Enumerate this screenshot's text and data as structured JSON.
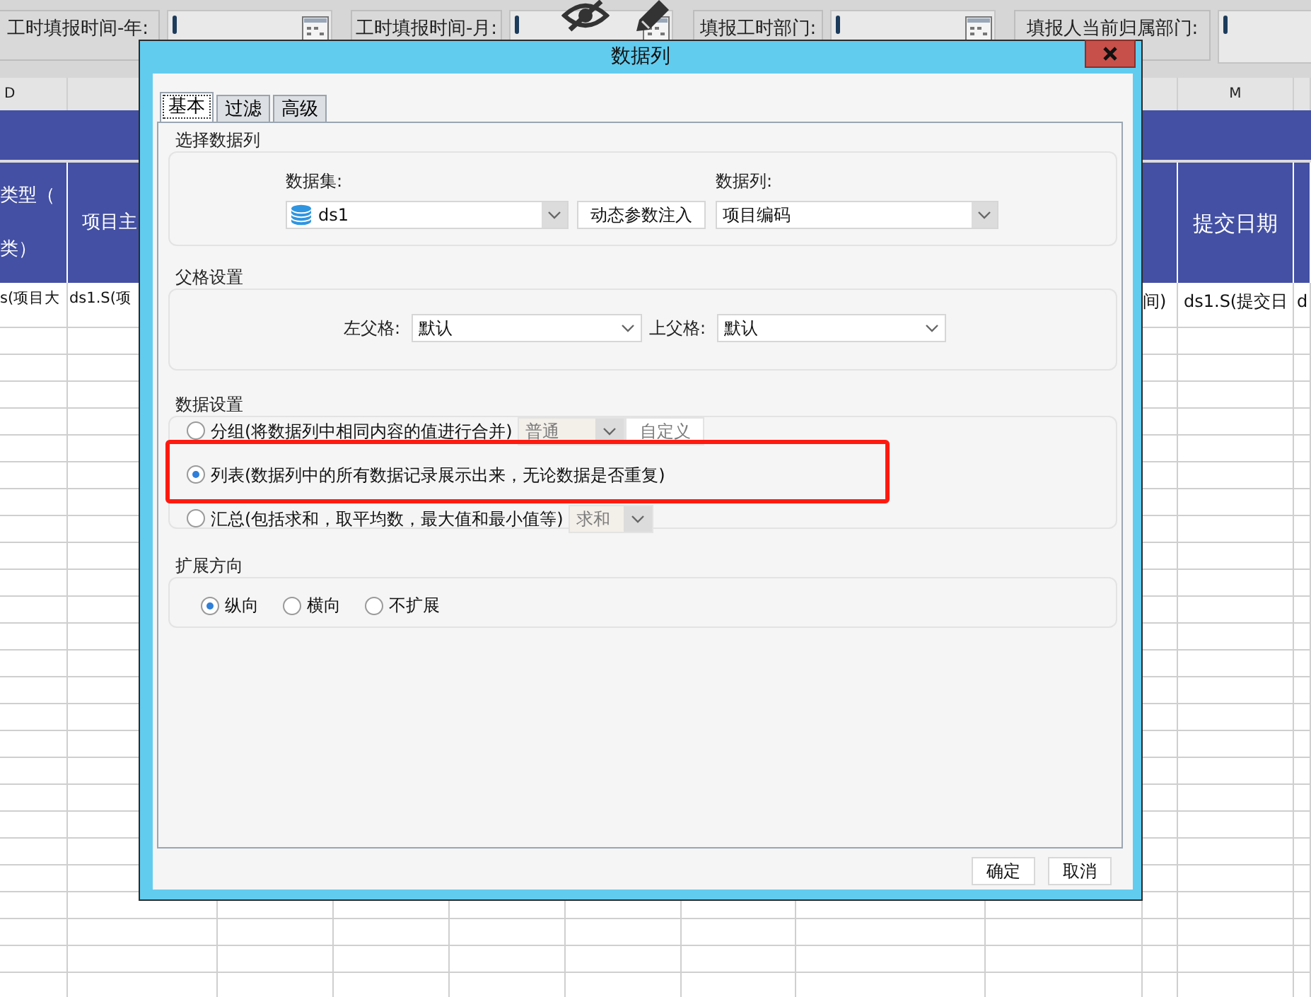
{
  "parameter_bar": [
    {
      "label": "工时填报时间-年:"
    },
    {
      "label": "工时填报时间-月:"
    },
    {
      "label": "填报工时部门:"
    },
    {
      "label": "填报人当前归属部门:"
    }
  ],
  "sheet": {
    "column_letters": [
      "D",
      "M"
    ],
    "header_cells": [
      {
        "lines": [
          "类型（",
          "类）"
        ]
      },
      {
        "lines": [
          "项目主"
        ]
      },
      {
        "lines": [
          "提交日期"
        ]
      }
    ],
    "data_cells": [
      "s(项目大",
      "ds1.S(项",
      "间)",
      "ds1.S(提交日",
      "d"
    ]
  },
  "dialog": {
    "title": "数据列",
    "tabs": [
      {
        "label": "基本",
        "selected": true
      },
      {
        "label": "过滤",
        "selected": false
      },
      {
        "label": "高级",
        "selected": false
      }
    ],
    "select_column": {
      "title": "选择数据列",
      "dataset_label": "数据集:",
      "dataset": {
        "value": "ds1"
      },
      "inject_button": "动态参数注入",
      "column_label": "数据列:",
      "column": {
        "value": "项目编码"
      }
    },
    "parent_settings": {
      "title": "父格设置",
      "left_label": "左父格:",
      "left": {
        "value": "默认"
      },
      "top_label": "上父格:",
      "top": {
        "value": "默认"
      }
    },
    "data_settings": {
      "title": "数据设置",
      "options": [
        {
          "label": "分组(将数据列中相同内容的值进行合并)",
          "selected": false,
          "highlighted": false,
          "extras": [
            {
              "kind": "combo",
              "value": "普通",
              "disabled": true
            },
            {
              "kind": "button",
              "label": "自定义",
              "disabled": true
            }
          ]
        },
        {
          "label": "列表(数据列中的所有数据记录展示出来，无论数据是否重复)",
          "selected": true,
          "highlighted": true
        },
        {
          "label": "汇总(包括求和，取平均数，最大值和最小值等)",
          "selected": false,
          "highlighted": false,
          "extras": [
            {
              "kind": "combo",
              "value": "求和",
              "disabled": true
            }
          ]
        }
      ]
    },
    "expand_direction": {
      "title": "扩展方向",
      "options": [
        {
          "label": "纵向",
          "selected": true
        },
        {
          "label": "横向",
          "selected": false
        },
        {
          "label": "不扩展",
          "selected": false
        }
      ]
    },
    "buttons": [
      "确定",
      "取消"
    ]
  }
}
